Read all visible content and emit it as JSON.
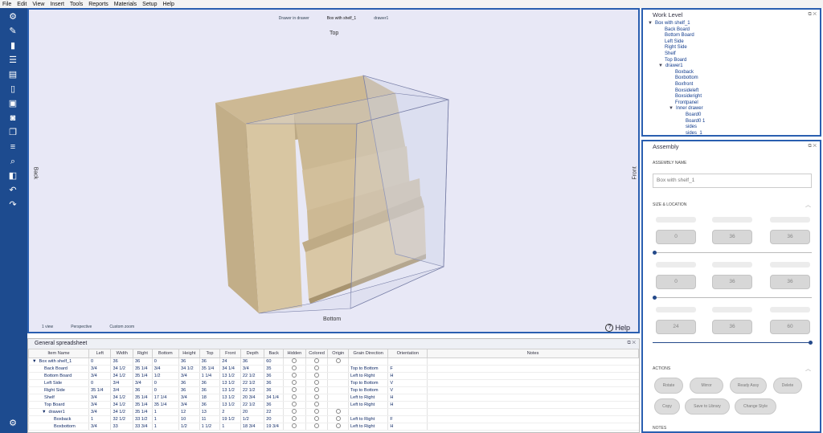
{
  "menu": [
    "File",
    "Edit",
    "View",
    "Insert",
    "Tools",
    "Reports",
    "Materials",
    "Setup",
    "Help"
  ],
  "viewport": {
    "top_selectors": [
      "Drawer in drawer",
      "Box with shelf_1",
      "drawer1"
    ],
    "label_top": "Top",
    "label_bottom": "Bottom",
    "label_left": "Back",
    "label_right": "Front",
    "bottom_controls": [
      "1 view",
      "Perspective",
      "Custom zoom"
    ],
    "help": "Help"
  },
  "spreadsheet": {
    "title": "General spreadsheet",
    "columns": [
      "Item Name",
      "Left",
      "Width",
      "Right",
      "Bottom",
      "Height",
      "Top",
      "Front",
      "Depth",
      "Back",
      "Hidden",
      "Colored",
      "Origin",
      "Grain Direction",
      "Orientation",
      "Notes"
    ],
    "rows": [
      {
        "name": "Box with shelf_1",
        "indent": 0,
        "tri": "▼",
        "cells": [
          "0",
          "36",
          "36",
          "0",
          "36",
          "36",
          "24",
          "36",
          "60"
        ],
        "grain": "",
        "orient": ""
      },
      {
        "name": "Back Board",
        "indent": 1,
        "tri": "",
        "cells": [
          "3/4",
          "34 1/2",
          "35 1/4",
          "3/4",
          "34 1/2",
          "35 1/4",
          "34 1/4",
          "3/4",
          "35"
        ],
        "grain": "Top to Bottom",
        "orient": "F"
      },
      {
        "name": "Bottom Board",
        "indent": 1,
        "tri": "",
        "cells": [
          "3/4",
          "34 1/2",
          "35 1/4",
          "1/2",
          "3/4",
          "1 1/4",
          "13 1/2",
          "22 1/2",
          "36"
        ],
        "grain": "Left to Right",
        "orient": "H"
      },
      {
        "name": "Left Side",
        "indent": 1,
        "tri": "",
        "cells": [
          "0",
          "3/4",
          "3/4",
          "0",
          "36",
          "36",
          "13 1/2",
          "22 1/2",
          "36"
        ],
        "grain": "Top to Bottom",
        "orient": "V"
      },
      {
        "name": "Right Side",
        "indent": 1,
        "tri": "",
        "cells": [
          "35 1/4",
          "3/4",
          "36",
          "0",
          "36",
          "36",
          "13 1/2",
          "22 1/2",
          "36"
        ],
        "grain": "Top to Bottom",
        "orient": "V"
      },
      {
        "name": "Shelf",
        "indent": 1,
        "tri": "",
        "cells": [
          "3/4",
          "34 1/2",
          "35 1/4",
          "17 1/4",
          "3/4",
          "18",
          "13 1/2",
          "20 3/4",
          "34 1/4"
        ],
        "grain": "Left to Right",
        "orient": "H"
      },
      {
        "name": "Top Board",
        "indent": 1,
        "tri": "",
        "cells": [
          "3/4",
          "34 1/2",
          "35 1/4",
          "35 1/4",
          "3/4",
          "36",
          "13 1/2",
          "22 1/2",
          "36"
        ],
        "grain": "Left to Right",
        "orient": "H"
      },
      {
        "name": "drawer1",
        "indent": 1,
        "tri": "▼",
        "cells": [
          "3/4",
          "34 1/2",
          "35 1/4",
          "1",
          "12",
          "13",
          "2",
          "20",
          "22"
        ],
        "grain": "",
        "orient": ""
      },
      {
        "name": "Boxback",
        "indent": 2,
        "tri": "",
        "cells": [
          "1",
          "32 1/2",
          "33 1/2",
          "1",
          "10",
          "11",
          "19 1/2",
          "1/2",
          "20"
        ],
        "grain": "Left to Right",
        "orient": "F"
      },
      {
        "name": "Boxbottom",
        "indent": 2,
        "tri": "",
        "cells": [
          "3/4",
          "33",
          "33 3/4",
          "1",
          "1/2",
          "1 1/2",
          "1",
          "18 3/4",
          "19 3/4"
        ],
        "grain": "Left to Right",
        "orient": "H"
      }
    ]
  },
  "work_level": {
    "title": "Work Level",
    "items": [
      {
        "label": "Box with shelf_1",
        "indent": 0,
        "tri": "▼"
      },
      {
        "label": "Back Board",
        "indent": 1,
        "tri": ""
      },
      {
        "label": "Bottom Board",
        "indent": 1,
        "tri": ""
      },
      {
        "label": "Left Side",
        "indent": 1,
        "tri": ""
      },
      {
        "label": "Right Side",
        "indent": 1,
        "tri": ""
      },
      {
        "label": "Shelf",
        "indent": 1,
        "tri": ""
      },
      {
        "label": "Top Board",
        "indent": 1,
        "tri": ""
      },
      {
        "label": "drawer1",
        "indent": 1,
        "tri": "▼"
      },
      {
        "label": "Boxback",
        "indent": 2,
        "tri": ""
      },
      {
        "label": "Boxbottom",
        "indent": 2,
        "tri": ""
      },
      {
        "label": "Boxfront",
        "indent": 2,
        "tri": ""
      },
      {
        "label": "Boxsideleft",
        "indent": 2,
        "tri": ""
      },
      {
        "label": "Boxsideright",
        "indent": 2,
        "tri": ""
      },
      {
        "label": "Frontpanel",
        "indent": 2,
        "tri": ""
      },
      {
        "label": "Inner drawer",
        "indent": 2,
        "tri": "▼"
      },
      {
        "label": "Board0",
        "indent": 3,
        "tri": ""
      },
      {
        "label": "Board0 1",
        "indent": 3,
        "tri": ""
      },
      {
        "label": "sides",
        "indent": 3,
        "tri": ""
      },
      {
        "label": "sides_1",
        "indent": 3,
        "tri": ""
      }
    ]
  },
  "assembly": {
    "title": "Assembly",
    "name_label": "ASSEMBLY NAME",
    "name_value": "Box with shelf_1",
    "size_label": "SIZE & LOCATION",
    "row1": [
      "0",
      "36",
      "36"
    ],
    "row2": [
      "0",
      "36",
      "36"
    ],
    "row3": [
      "24",
      "36",
      "60"
    ],
    "actions_label": "ACTIONS",
    "actions": [
      "Rotate",
      "Mirror",
      "Ready Assy",
      "Delete",
      "Copy",
      "Save to Library",
      "Change Style"
    ],
    "notes_label": "NOTES"
  },
  "colors": {
    "accent": "#2a5fb0",
    "toolbar": "#1d4b8f",
    "wood": "#d9c7a5"
  }
}
